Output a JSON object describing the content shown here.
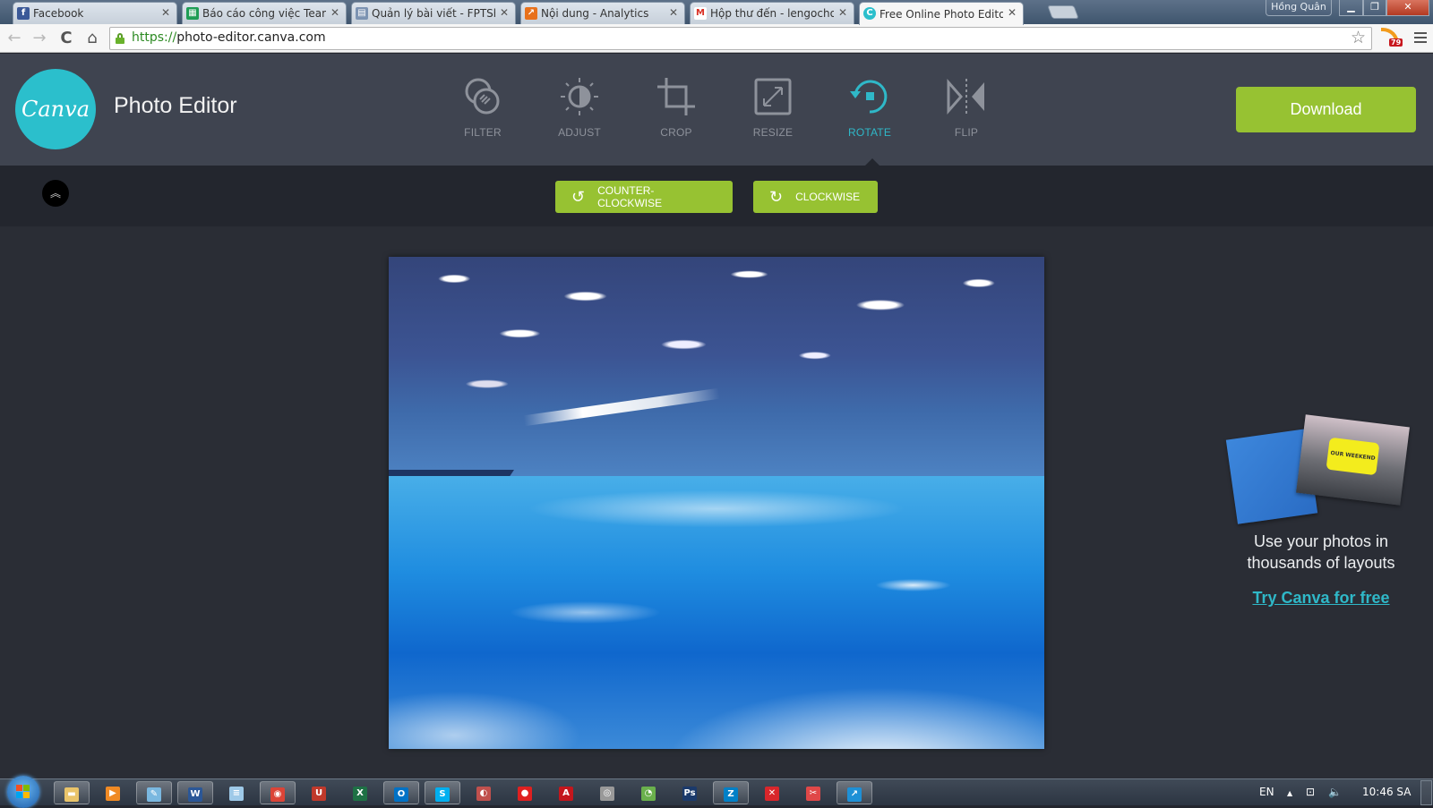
{
  "browser": {
    "tabs": [
      {
        "label": "Facebook",
        "favicon": "facebook-icon",
        "color": "#3b5998",
        "glyph": "f",
        "active": false
      },
      {
        "label": "Báo cáo công việc Team C",
        "favicon": "sheets-icon",
        "color": "#1f9d55",
        "glyph": "▦",
        "active": false
      },
      {
        "label": "Quản lý bài viết - FPTShop",
        "favicon": "document-icon",
        "color": "#7c93b2",
        "glyph": "▤",
        "active": false
      },
      {
        "label": "Nội dung - Analytics",
        "favicon": "analytics-icon",
        "color": "#e8711c",
        "glyph": "↗",
        "active": false
      },
      {
        "label": "Hộp thư đến - lengochong",
        "favicon": "gmail-icon",
        "color": "#d93025",
        "glyph": "M",
        "active": false
      },
      {
        "label": "Free Online Photo Editor -",
        "favicon": "canva-icon",
        "color": "#2bbfcc",
        "glyph": "C",
        "active": true
      }
    ],
    "tab_close_glyph": "✕",
    "profile_name": "Hồng Quân",
    "window_controls": {
      "minimize": "▁",
      "restore": "❐",
      "close": "✕"
    },
    "nav": {
      "back": "←",
      "forward": "→",
      "reload": "C",
      "home": "⌂"
    },
    "url": {
      "scheme": "https://",
      "host": "photo-editor.canva.com"
    },
    "bookmark_glyph": "☆",
    "rss_badge_count": "79"
  },
  "app": {
    "logo_text": "Canva",
    "title": "Photo Editor",
    "tools": [
      {
        "id": "filter",
        "label": "FILTER",
        "active": false
      },
      {
        "id": "adjust",
        "label": "ADJUST",
        "active": false
      },
      {
        "id": "crop",
        "label": "CROP",
        "active": false
      },
      {
        "id": "resize",
        "label": "RESIZE",
        "active": false
      },
      {
        "id": "rotate",
        "label": "ROTATE",
        "active": true
      },
      {
        "id": "flip",
        "label": "FLIP",
        "active": false
      }
    ],
    "download_label": "Download",
    "accent_color": "#2fb8c8",
    "button_color": "#97c232"
  },
  "subbar": {
    "collapse_glyph": "︽",
    "counter_clockwise_label": "COUNTER-CLOCKWISE",
    "counter_clockwise_glyph": "↺",
    "clockwise_label": "CLOCKWISE",
    "clockwise_glyph": "↻"
  },
  "canvas": {
    "image_description": "Upside-down photo: ocean with whitecaps on top, blue sky with clouds on bottom"
  },
  "promo": {
    "card_text": "OUR WEEKEND",
    "text": "Use your photos in thousands of layouts",
    "link": "Try Canva for free"
  },
  "taskbar": {
    "apps": [
      {
        "name": "file-explorer",
        "glyph": "▬",
        "color": "#e9c46a",
        "open": true
      },
      {
        "name": "media-player",
        "glyph": "▶",
        "color": "#f08a24",
        "open": false
      },
      {
        "name": "paint",
        "glyph": "✎",
        "color": "#7ab8e0",
        "open": true
      },
      {
        "name": "word",
        "glyph": "W",
        "color": "#2b5797",
        "open": true
      },
      {
        "name": "notepad",
        "glyph": "≡",
        "color": "#9ec9e8",
        "open": false
      },
      {
        "name": "chrome",
        "glyph": "◉",
        "color": "#db4437",
        "open": true
      },
      {
        "name": "unikey",
        "glyph": "U",
        "color": "#c0392b",
        "open": false
      },
      {
        "name": "excel",
        "glyph": "X",
        "color": "#1e7145",
        "open": false
      },
      {
        "name": "outlook",
        "glyph": "O",
        "color": "#0072c6",
        "open": true
      },
      {
        "name": "skype",
        "glyph": "S",
        "color": "#00aff0",
        "open": true
      },
      {
        "name": "pinned-app-1",
        "glyph": "◐",
        "color": "#c0504d",
        "open": false
      },
      {
        "name": "pinned-app-2",
        "glyph": "●",
        "color": "#e02020",
        "open": false
      },
      {
        "name": "acrobat",
        "glyph": "A",
        "color": "#c4161c",
        "open": false
      },
      {
        "name": "pinned-app-3",
        "glyph": "◎",
        "color": "#999999",
        "open": false
      },
      {
        "name": "pinned-app-4",
        "glyph": "◔",
        "color": "#6ab04c",
        "open": false
      },
      {
        "name": "photoshop",
        "glyph": "Ps",
        "color": "#1b3a6b",
        "open": false
      },
      {
        "name": "zalo",
        "glyph": "Z",
        "color": "#0180c7",
        "open": true
      },
      {
        "name": "pinned-app-5",
        "glyph": "✕",
        "color": "#d9262b",
        "open": false
      },
      {
        "name": "pinned-app-6",
        "glyph": "✂",
        "color": "#e04848",
        "open": false
      },
      {
        "name": "teamviewer",
        "glyph": "↗",
        "color": "#1e90d6",
        "open": true
      }
    ],
    "language": "EN",
    "tray_expand_glyph": "▲",
    "network_glyph": "⊡",
    "volume_glyph": "🔈",
    "clock": "10:46 SA"
  }
}
